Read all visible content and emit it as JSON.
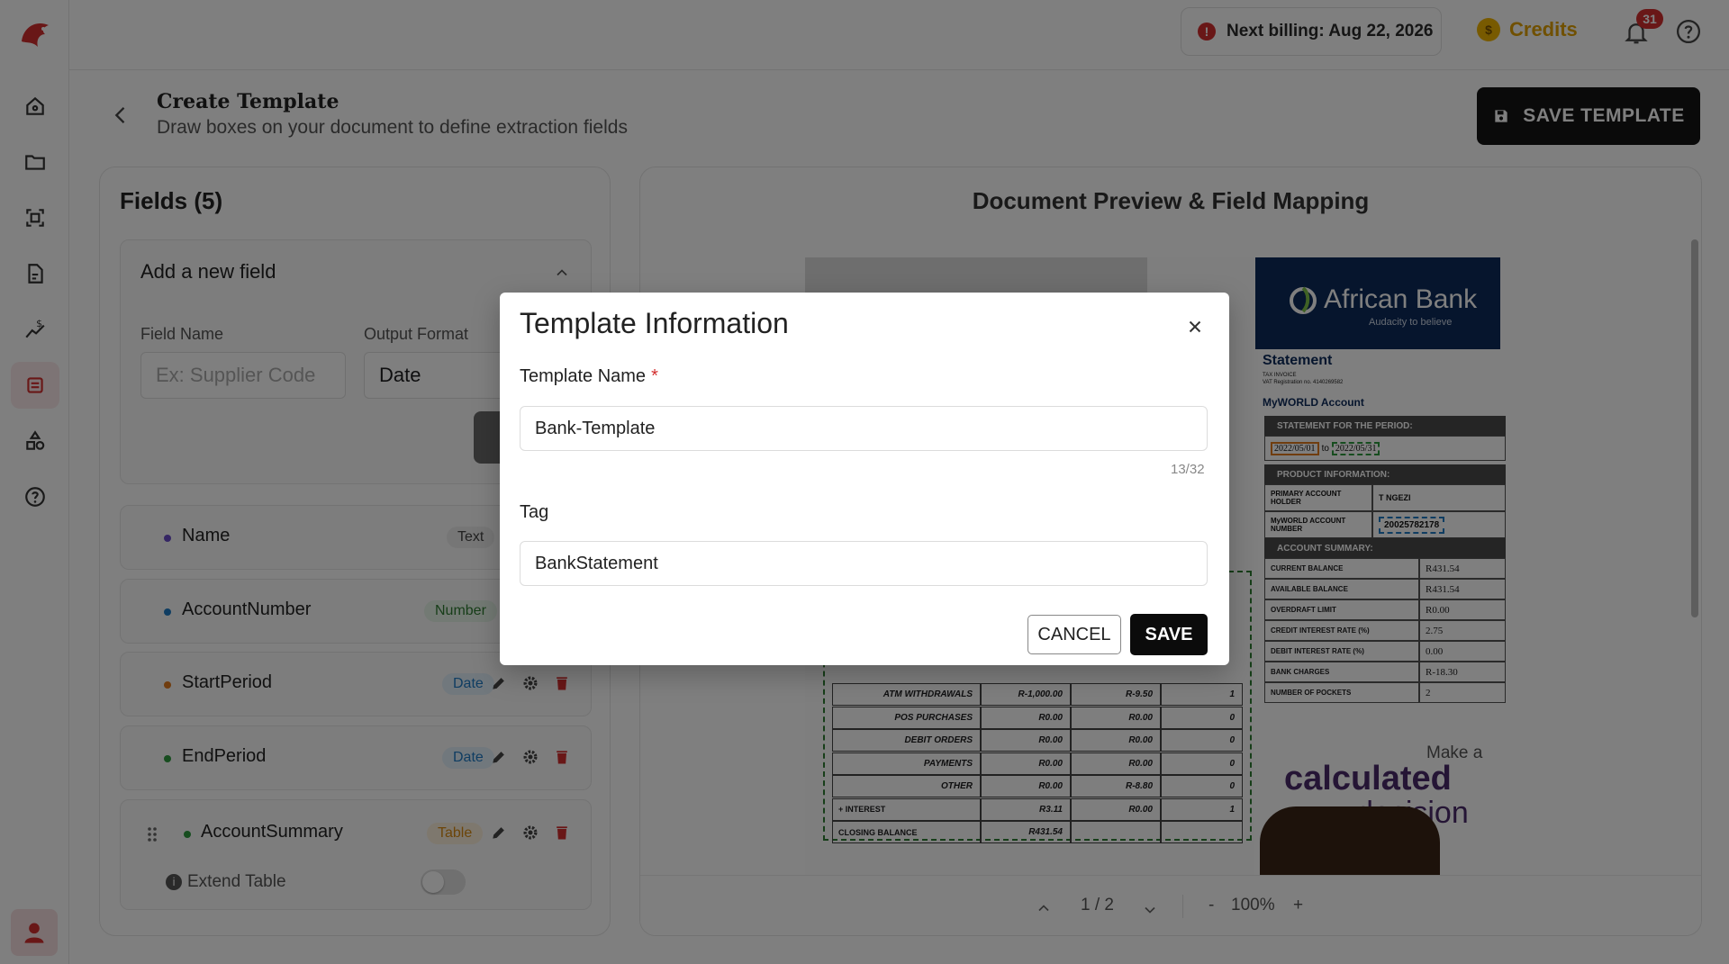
{
  "topbar": {
    "billing_text": "Next billing: Aug 22, 2026",
    "credits_label": "Credits",
    "notifications_count": "31"
  },
  "header": {
    "title": "Create Template",
    "subtitle": "Draw boxes on your document to define extraction fields",
    "save_template_label": "SAVE TEMPLATE"
  },
  "fields_panel": {
    "title": "Fields (5)",
    "add_section_title": "Add a new field",
    "field_name_label": "Field Name",
    "field_name_placeholder": "Ex: Supplier Code",
    "output_format_label": "Output Format",
    "output_format_value": "Date",
    "extend_table_label": "Extend Table",
    "fields": [
      {
        "name": "Name",
        "type": "Text",
        "dot_color": "#6a4cc9"
      },
      {
        "name": "AccountNumber",
        "type": "Number",
        "dot_color": "#1f7ac4"
      },
      {
        "name": "StartPeriod",
        "type": "Date",
        "dot_color": "#e07a1f"
      },
      {
        "name": "EndPeriod",
        "type": "Date",
        "dot_color": "#2e9a3e"
      },
      {
        "name": "AccountSummary",
        "type": "Table",
        "dot_color": "#2e9a3e"
      }
    ]
  },
  "preview": {
    "title": "Document Preview & Field Mapping",
    "page_indicator": "1 / 2",
    "zoom": "100%",
    "zoom_out": "-",
    "zoom_in": "+",
    "document": {
      "bank_name": "African Bank",
      "bank_tagline": "Audacity to believe",
      "statement_title": "Statement",
      "tax_invoice": "TAX INVOICE",
      "vat_line": "VAT Registration no. 4140269582",
      "account_label": "MyWORLD Account",
      "period_header": "STATEMENT FOR THE PERIOD:",
      "period_start": "2022/05/01",
      "period_to": "to",
      "period_end": "2022/05/31",
      "product_header": "PRODUCT INFORMATION:",
      "primary_holder_label": "PRIMARY ACCOUNT HOLDER",
      "primary_holder_value": "T NGEZI",
      "account_number_label": "MyWORLD ACCOUNT NUMBER",
      "account_number_value": "20025782178",
      "summary_header": "ACCOUNT SUMMARY:",
      "summary": [
        {
          "k": "CURRENT BALANCE",
          "v": "R431.54"
        },
        {
          "k": "AVAILABLE BALANCE",
          "v": "R431.54"
        },
        {
          "k": "OVERDRAFT LIMIT",
          "v": "R0.00"
        },
        {
          "k": "CREDIT INTEREST RATE (%)",
          "v": "2.75"
        },
        {
          "k": "DEBIT INTEREST RATE (%)",
          "v": "0.00"
        },
        {
          "k": "BANK CHARGES",
          "v": "R-18.30"
        },
        {
          "k": "NUMBER OF POCKETS",
          "v": "2"
        }
      ],
      "transactions": [
        [
          "ATM WITHDRAWALS",
          "R-1,000.00",
          "R-9.50",
          "1"
        ],
        [
          "POS PURCHASES",
          "R0.00",
          "R0.00",
          "0"
        ],
        [
          "DEBIT ORDERS",
          "R0.00",
          "R0.00",
          "0"
        ],
        [
          "PAYMENTS",
          "R0.00",
          "R0.00",
          "0"
        ],
        [
          "OTHER",
          "R0.00",
          "R-8.80",
          "0"
        ],
        [
          "+ INTEREST",
          "R3.11",
          "R0.00",
          "1"
        ],
        [
          "CLOSING BALANCE",
          "R431.54",
          "",
          ""
        ]
      ],
      "ad_line1": "Make a",
      "ad_line2": "calculated",
      "ad_line3": "decision"
    }
  },
  "modal": {
    "title": "Template Information",
    "template_name_label": "Template Name",
    "required_marker": "*",
    "template_name_value": "Bank-Template",
    "char_counter": "13/32",
    "tag_label": "Tag",
    "tag_value": "BankStatement",
    "cancel_label": "CANCEL",
    "save_label": "SAVE"
  }
}
